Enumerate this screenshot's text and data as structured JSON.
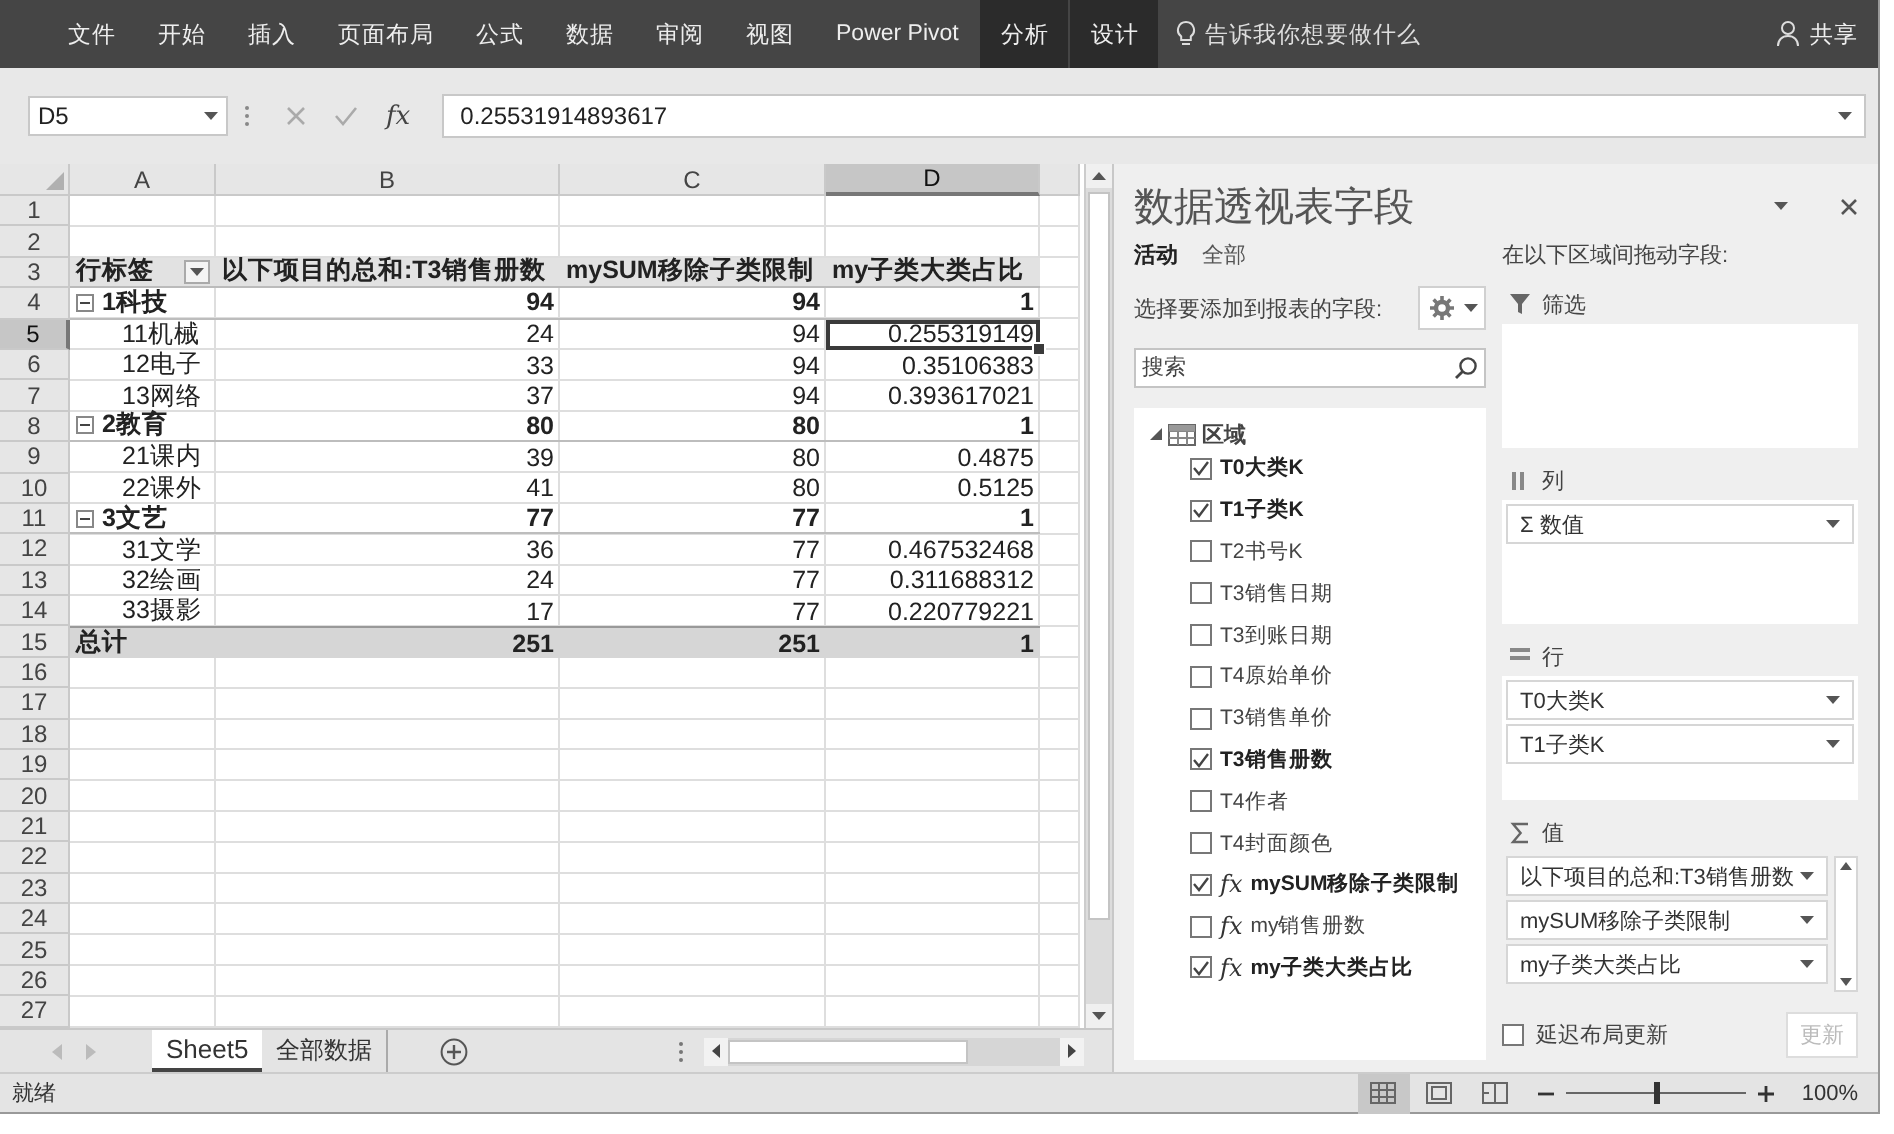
{
  "ribbon": {
    "tabs": [
      {
        "label": "文件",
        "selected": false
      },
      {
        "label": "开始",
        "selected": false
      },
      {
        "label": "插入",
        "selected": false
      },
      {
        "label": "页面布局",
        "selected": false
      },
      {
        "label": "公式",
        "selected": false
      },
      {
        "label": "数据",
        "selected": false
      },
      {
        "label": "审阅",
        "selected": false
      },
      {
        "label": "视图",
        "selected": false
      },
      {
        "label": "Power Pivot",
        "selected": false
      },
      {
        "label": "分析",
        "selected": true
      },
      {
        "label": "设计",
        "selected": true
      }
    ],
    "tell_me": "告诉我你想要做什么",
    "share": "共享"
  },
  "formula_bar": {
    "name_box": "D5",
    "function_symbol": "fx",
    "value": "0.25531914893617"
  },
  "sheet": {
    "columns": [
      {
        "label": "A",
        "selected": false
      },
      {
        "label": "B",
        "selected": false
      },
      {
        "label": "C",
        "selected": false
      },
      {
        "label": "D",
        "selected": true
      }
    ],
    "rows": [
      {
        "number": "1",
        "kind": "empty",
        "selected": false
      },
      {
        "number": "2",
        "kind": "empty",
        "selected": false
      },
      {
        "number": "3",
        "kind": "header",
        "selected": false,
        "cells": [
          "行标签",
          "以下项目的总和:T3销售册数",
          "mySUM移除子类限制",
          "my子类大类占比"
        ]
      },
      {
        "number": "4",
        "kind": "group",
        "expanded": true,
        "selected": false,
        "cells": [
          "1科技",
          "94",
          "94",
          "1"
        ]
      },
      {
        "number": "5",
        "kind": "item",
        "selected": true,
        "cells": [
          "11机械",
          "24",
          "94",
          "0.255319149"
        ]
      },
      {
        "number": "6",
        "kind": "item",
        "selected": false,
        "cells": [
          "12电子",
          "33",
          "94",
          "0.35106383"
        ]
      },
      {
        "number": "7",
        "kind": "item",
        "selected": false,
        "cells": [
          "13网络",
          "37",
          "94",
          "0.393617021"
        ]
      },
      {
        "number": "8",
        "kind": "group",
        "expanded": true,
        "selected": false,
        "cells": [
          "2教育",
          "80",
          "80",
          "1"
        ]
      },
      {
        "number": "9",
        "kind": "item",
        "selected": false,
        "cells": [
          "21课内",
          "39",
          "80",
          "0.4875"
        ]
      },
      {
        "number": "10",
        "kind": "item",
        "selected": false,
        "cells": [
          "22课外",
          "41",
          "80",
          "0.5125"
        ]
      },
      {
        "number": "11",
        "kind": "group",
        "expanded": true,
        "selected": false,
        "cells": [
          "3文艺",
          "77",
          "77",
          "1"
        ]
      },
      {
        "number": "12",
        "kind": "item",
        "selected": false,
        "cells": [
          "31文学",
          "36",
          "77",
          "0.467532468"
        ]
      },
      {
        "number": "13",
        "kind": "item",
        "selected": false,
        "cells": [
          "32绘画",
          "24",
          "77",
          "0.311688312"
        ]
      },
      {
        "number": "14",
        "kind": "item",
        "selected": false,
        "cells": [
          "33摄影",
          "17",
          "77",
          "0.220779221"
        ]
      },
      {
        "number": "15",
        "kind": "total",
        "selected": false,
        "cells": [
          "总计",
          "251",
          "251",
          "1"
        ]
      },
      {
        "number": "16",
        "kind": "empty",
        "selected": false
      },
      {
        "number": "17",
        "kind": "empty",
        "selected": false
      },
      {
        "number": "18",
        "kind": "empty",
        "selected": false
      },
      {
        "number": "19",
        "kind": "empty",
        "selected": false
      },
      {
        "number": "20",
        "kind": "empty",
        "selected": false
      },
      {
        "number": "21",
        "kind": "empty",
        "selected": false
      },
      {
        "number": "22",
        "kind": "empty",
        "selected": false
      },
      {
        "number": "23",
        "kind": "empty",
        "selected": false
      },
      {
        "number": "24",
        "kind": "empty",
        "selected": false
      },
      {
        "number": "25",
        "kind": "empty",
        "selected": false
      },
      {
        "number": "26",
        "kind": "empty",
        "selected": false
      },
      {
        "number": "27",
        "kind": "empty",
        "selected": false
      }
    ]
  },
  "sheet_tabs": [
    {
      "label": "Sheet5",
      "selected": true
    },
    {
      "label": "全部数据",
      "selected": false
    }
  ],
  "pivot_pane": {
    "title": "数据透视表字段",
    "tabs": [
      {
        "label": "活动",
        "selected": true
      },
      {
        "label": "全部",
        "selected": false
      }
    ],
    "prompt": "选择要添加到报表的字段:",
    "search": {
      "placeholder": "搜索"
    },
    "table": {
      "label": "区域",
      "expanded": true,
      "fields": [
        {
          "label": "T0大类K",
          "checked": true
        },
        {
          "label": "T1子类K",
          "checked": true
        },
        {
          "label": "T2书号K",
          "checked": false
        },
        {
          "label": "T3销售日期",
          "checked": false
        },
        {
          "label": "T3到账日期",
          "checked": false
        },
        {
          "label": "T4原始单价",
          "checked": false
        },
        {
          "label": "T3销售单价",
          "checked": false
        },
        {
          "label": "T3销售册数",
          "checked": true
        },
        {
          "label": "T4作者",
          "checked": false
        },
        {
          "label": "T4封面颜色",
          "checked": false
        },
        {
          "label": "mySUM移除子类限制",
          "checked": true,
          "prefix": "fx"
        },
        {
          "label": "my销售册数",
          "checked": false,
          "prefix": "fx"
        },
        {
          "label": "my子类大类占比",
          "checked": true,
          "prefix": "fx"
        }
      ]
    },
    "hint": "在以下区域间拖动字段:",
    "areas": [
      {
        "kind": "filter",
        "label": "筛选"
      },
      {
        "kind": "columns",
        "label": "列",
        "items": [
          "Σ 数值"
        ]
      },
      {
        "kind": "rows",
        "label": "行",
        "items": [
          "T0大类K",
          "T1子类K"
        ]
      },
      {
        "kind": "values",
        "label": "值",
        "items": [
          "以下项目的总和:T3销售册数",
          "mySUM移除子类限制",
          "my子类大类占比"
        ]
      }
    ],
    "defer_update": {
      "label": "延迟布局更新",
      "checked": false
    },
    "update_button": {
      "label": "更新",
      "disabled": true
    }
  },
  "status_bar": {
    "status": "就绪",
    "views": [
      {
        "kind": "normal",
        "selected": true
      },
      {
        "kind": "page_layout",
        "selected": false
      },
      {
        "kind": "page_break",
        "selected": false
      }
    ],
    "zoom": {
      "level": 0.5,
      "label": "100%"
    }
  }
}
